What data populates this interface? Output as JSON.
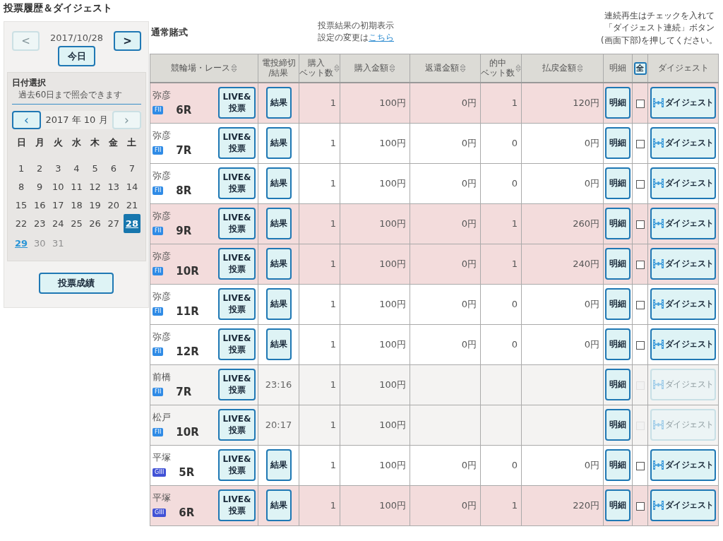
{
  "page_title": "投票履歴＆ダイジェスト",
  "date_nav": {
    "date": "2017/10/28",
    "prev": {
      "label": "<",
      "disabled": true
    },
    "next": {
      "label": ">",
      "disabled": false
    },
    "today_button": "今日"
  },
  "calendar": {
    "title": "日付選択",
    "note": "過去60日まで照会できます",
    "month": "2017 年 10 月",
    "prev": {
      "label": "‹",
      "disabled": false
    },
    "next": {
      "label": "›",
      "disabled": true
    },
    "weekdays": [
      "日",
      "月",
      "火",
      "水",
      "木",
      "金",
      "土"
    ],
    "weeks": [
      [
        {
          "label": "1",
          "selected": false,
          "today": false,
          "disabled": false
        },
        {
          "label": "2",
          "selected": false,
          "today": false,
          "disabled": false
        },
        {
          "label": "3",
          "selected": false,
          "today": false,
          "disabled": false
        },
        {
          "label": "4",
          "selected": false,
          "today": false,
          "disabled": false
        },
        {
          "label": "5",
          "selected": false,
          "today": false,
          "disabled": false
        },
        {
          "label": "6",
          "selected": false,
          "today": false,
          "disabled": false
        },
        {
          "label": "7",
          "selected": false,
          "today": false,
          "disabled": false
        }
      ],
      [
        {
          "label": "8",
          "selected": false,
          "today": false,
          "disabled": false
        },
        {
          "label": "9",
          "selected": false,
          "today": false,
          "disabled": false
        },
        {
          "label": "10",
          "selected": false,
          "today": false,
          "disabled": false
        },
        {
          "label": "11",
          "selected": false,
          "today": false,
          "disabled": false
        },
        {
          "label": "12",
          "selected": false,
          "today": false,
          "disabled": false
        },
        {
          "label": "13",
          "selected": false,
          "today": false,
          "disabled": false
        },
        {
          "label": "14",
          "selected": false,
          "today": false,
          "disabled": false
        }
      ],
      [
        {
          "label": "15",
          "selected": false,
          "today": false,
          "disabled": false
        },
        {
          "label": "16",
          "selected": false,
          "today": false,
          "disabled": false
        },
        {
          "label": "17",
          "selected": false,
          "today": false,
          "disabled": false
        },
        {
          "label": "18",
          "selected": false,
          "today": false,
          "disabled": false
        },
        {
          "label": "19",
          "selected": false,
          "today": false,
          "disabled": false
        },
        {
          "label": "20",
          "selected": false,
          "today": false,
          "disabled": false
        },
        {
          "label": "21",
          "selected": false,
          "today": false,
          "disabled": false
        }
      ],
      [
        {
          "label": "22",
          "selected": false,
          "today": false,
          "disabled": false
        },
        {
          "label": "23",
          "selected": false,
          "today": false,
          "disabled": false
        },
        {
          "label": "24",
          "selected": false,
          "today": false,
          "disabled": false
        },
        {
          "label": "25",
          "selected": false,
          "today": false,
          "disabled": false
        },
        {
          "label": "26",
          "selected": false,
          "today": false,
          "disabled": false
        },
        {
          "label": "27",
          "selected": false,
          "today": false,
          "disabled": false
        },
        {
          "label": "28",
          "selected": true,
          "today": false,
          "disabled": false
        }
      ],
      [
        {
          "label": "29",
          "selected": false,
          "today": true,
          "disabled": false
        },
        {
          "label": "30",
          "selected": false,
          "today": false,
          "disabled": true
        },
        {
          "label": "31",
          "selected": false,
          "today": false,
          "disabled": true
        }
      ]
    ]
  },
  "results_button": "投票成績",
  "section_title": "通常賭式",
  "display_note": {
    "text": "投票結果の初期表示",
    "text2": "設定の変更は",
    "link": "こちら"
  },
  "digest_note": [
    "連続再生はチェックを入れて",
    "「ダイジェスト連続」ボタン",
    "(画面下部)を押してください。"
  ],
  "table": {
    "columns": [
      {
        "lines": [
          "競輪場・レース"
        ],
        "sortable": true
      },
      {
        "lines": [
          "電投締切",
          "/結果"
        ],
        "sortable": false
      },
      {
        "lines": [
          "購入",
          "ベット数"
        ],
        "sortable": true
      },
      {
        "lines": [
          "購入金額"
        ],
        "sortable": true
      },
      {
        "lines": [
          "返還金額"
        ],
        "sortable": true
      },
      {
        "lines": [
          "的中",
          "ベット数"
        ],
        "sortable": true
      },
      {
        "lines": [
          "払戻金額"
        ],
        "sortable": true
      },
      {
        "lines": [
          "明細"
        ],
        "sortable": false
      },
      {
        "lines": [
          "全"
        ],
        "kind": "select_all"
      },
      {
        "lines": [
          "ダイジェスト"
        ],
        "sortable": false
      }
    ],
    "rows": [
      {
        "venue": "弥彦",
        "grade": {
          "label": "FII",
          "color": "#2f8be6"
        },
        "race": "6R",
        "live_button": [
          "LIVE&",
          "投票"
        ],
        "result": {
          "kind": "button",
          "label": "結果"
        },
        "bets": "1",
        "amount": "100円",
        "refund": "0円",
        "hits": "1",
        "payout": "120円",
        "detail_button": "明細",
        "won": true,
        "settled": true,
        "checked": false,
        "digest_button": "ダイジェスト"
      },
      {
        "venue": "弥彦",
        "grade": {
          "label": "FII",
          "color": "#2f8be6"
        },
        "race": "7R",
        "live_button": [
          "LIVE&",
          "投票"
        ],
        "result": {
          "kind": "button",
          "label": "結果"
        },
        "bets": "1",
        "amount": "100円",
        "refund": "0円",
        "hits": "0",
        "payout": "0円",
        "detail_button": "明細",
        "won": false,
        "settled": true,
        "checked": false,
        "digest_button": "ダイジェスト"
      },
      {
        "venue": "弥彦",
        "grade": {
          "label": "FII",
          "color": "#2f8be6"
        },
        "race": "8R",
        "live_button": [
          "LIVE&",
          "投票"
        ],
        "result": {
          "kind": "button",
          "label": "結果"
        },
        "bets": "1",
        "amount": "100円",
        "refund": "0円",
        "hits": "0",
        "payout": "0円",
        "detail_button": "明細",
        "won": false,
        "settled": true,
        "checked": false,
        "digest_button": "ダイジェスト"
      },
      {
        "venue": "弥彦",
        "grade": {
          "label": "FII",
          "color": "#2f8be6"
        },
        "race": "9R",
        "live_button": [
          "LIVE&",
          "投票"
        ],
        "result": {
          "kind": "button",
          "label": "結果"
        },
        "bets": "1",
        "amount": "100円",
        "refund": "0円",
        "hits": "1",
        "payout": "260円",
        "detail_button": "明細",
        "won": true,
        "settled": true,
        "checked": false,
        "digest_button": "ダイジェスト"
      },
      {
        "venue": "弥彦",
        "grade": {
          "label": "FII",
          "color": "#2f8be6"
        },
        "race": "10R",
        "live_button": [
          "LIVE&",
          "投票"
        ],
        "result": {
          "kind": "button",
          "label": "結果"
        },
        "bets": "1",
        "amount": "100円",
        "refund": "0円",
        "hits": "1",
        "payout": "240円",
        "detail_button": "明細",
        "won": true,
        "settled": true,
        "checked": false,
        "digest_button": "ダイジェスト"
      },
      {
        "venue": "弥彦",
        "grade": {
          "label": "FII",
          "color": "#2f8be6"
        },
        "race": "11R",
        "live_button": [
          "LIVE&",
          "投票"
        ],
        "result": {
          "kind": "button",
          "label": "結果"
        },
        "bets": "1",
        "amount": "100円",
        "refund": "0円",
        "hits": "0",
        "payout": "0円",
        "detail_button": "明細",
        "won": false,
        "settled": true,
        "checked": false,
        "digest_button": "ダイジェスト"
      },
      {
        "venue": "弥彦",
        "grade": {
          "label": "FII",
          "color": "#2f8be6"
        },
        "race": "12R",
        "live_button": [
          "LIVE&",
          "投票"
        ],
        "result": {
          "kind": "button",
          "label": "結果"
        },
        "bets": "1",
        "amount": "100円",
        "refund": "0円",
        "hits": "0",
        "payout": "0円",
        "detail_button": "明細",
        "won": false,
        "settled": true,
        "checked": false,
        "digest_button": "ダイジェスト"
      },
      {
        "venue": "前橋",
        "grade": {
          "label": "FII",
          "color": "#2f8be6"
        },
        "race": "7R",
        "live_button": [
          "LIVE&",
          "投票"
        ],
        "result": {
          "kind": "time",
          "label": "23:16"
        },
        "bets": "1",
        "amount": "100円",
        "detail_button": "明細",
        "won": false,
        "settled": false,
        "checked": false,
        "digest_button": "ダイジェスト"
      },
      {
        "venue": "松戸",
        "grade": {
          "label": "FII",
          "color": "#2f8be6"
        },
        "race": "10R",
        "live_button": [
          "LIVE&",
          "投票"
        ],
        "result": {
          "kind": "time",
          "label": "20:17"
        },
        "bets": "1",
        "amount": "100円",
        "detail_button": "明細",
        "won": false,
        "settled": false,
        "checked": false,
        "digest_button": "ダイジェスト"
      },
      {
        "venue": "平塚",
        "grade": {
          "label": "GIII",
          "color": "#4152d6"
        },
        "race": "5R",
        "live_button": [
          "LIVE&",
          "投票"
        ],
        "result": {
          "kind": "button",
          "label": "結果"
        },
        "bets": "1",
        "amount": "100円",
        "refund": "0円",
        "hits": "0",
        "payout": "0円",
        "detail_button": "明細",
        "won": false,
        "settled": true,
        "checked": false,
        "digest_button": "ダイジェスト"
      },
      {
        "venue": "平塚",
        "grade": {
          "label": "GIII",
          "color": "#4152d6"
        },
        "race": "6R",
        "live_button": [
          "LIVE&",
          "投票"
        ],
        "result": {
          "kind": "button",
          "label": "結果"
        },
        "bets": "1",
        "amount": "100円",
        "refund": "0円",
        "hits": "1",
        "payout": "220円",
        "detail_button": "明細",
        "won": true,
        "settled": true,
        "checked": false,
        "digest_button": "ダイジェスト"
      }
    ]
  }
}
